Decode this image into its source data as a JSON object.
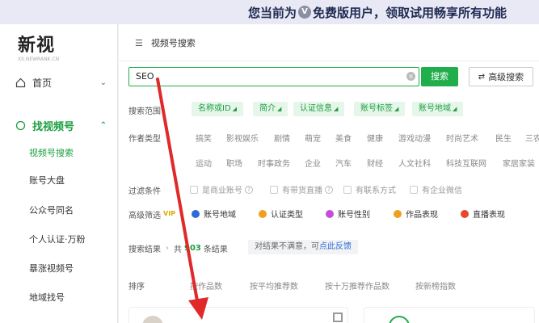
{
  "banner": {
    "prefix": "您当前为",
    "text": "免费版用户，领取试用畅享所有功能"
  },
  "sidebar": {
    "logo": "新视",
    "logo_sub": "XS.NEWRANK.CN",
    "home": "首页",
    "group": "找视频号",
    "items": [
      "视频号搜索",
      "账号大盘",
      "公众号同名",
      "个人认证·万粉",
      "暴涨视频号",
      "地域找号"
    ]
  },
  "main": {
    "breadcrumb": "视频号搜索",
    "search_value": "SEO",
    "search_button": "搜索",
    "advanced_button": "高级搜索",
    "scope_label": "搜索范围",
    "scope_chips": [
      "名称或ID",
      "简介",
      "认证信息",
      "账号标签",
      "账号地域"
    ],
    "author_label": "作者类型",
    "categories_row1": [
      "搞笑",
      "影视娱乐",
      "剧情",
      "萌宠",
      "美食",
      "健康",
      "游戏动漫",
      "时尚艺术",
      "民生",
      "三农"
    ],
    "categories_row2": [
      "运动",
      "职场",
      "时事政务",
      "企业",
      "汽车",
      "财经",
      "人文社科",
      "科技互联网",
      "家居家装"
    ],
    "filter_label": "过滤条件",
    "filters": [
      "是商业账号",
      "有带货直播",
      "有联系方式",
      "有企业微信"
    ],
    "advanced_label": "高级筛选",
    "vip_tag": "VIP",
    "advanced_items": [
      "账号地域",
      "认证类型",
      "账号性别",
      "作品表现",
      "直播表现"
    ],
    "results_label": "搜索结果",
    "results_prefix": "共",
    "results_count": "903",
    "results_suffix": "条结果",
    "feedback_text": "对结果不满意，可",
    "feedback_link": "点此反馈",
    "sort_label": "排序",
    "sort_options": [
      "按作品数",
      "按平均推荐数",
      "按十万推荐作品数",
      "按新榜指数"
    ]
  },
  "colors": {
    "accent": "#1fae4b",
    "arrow": "#e02a2a"
  }
}
